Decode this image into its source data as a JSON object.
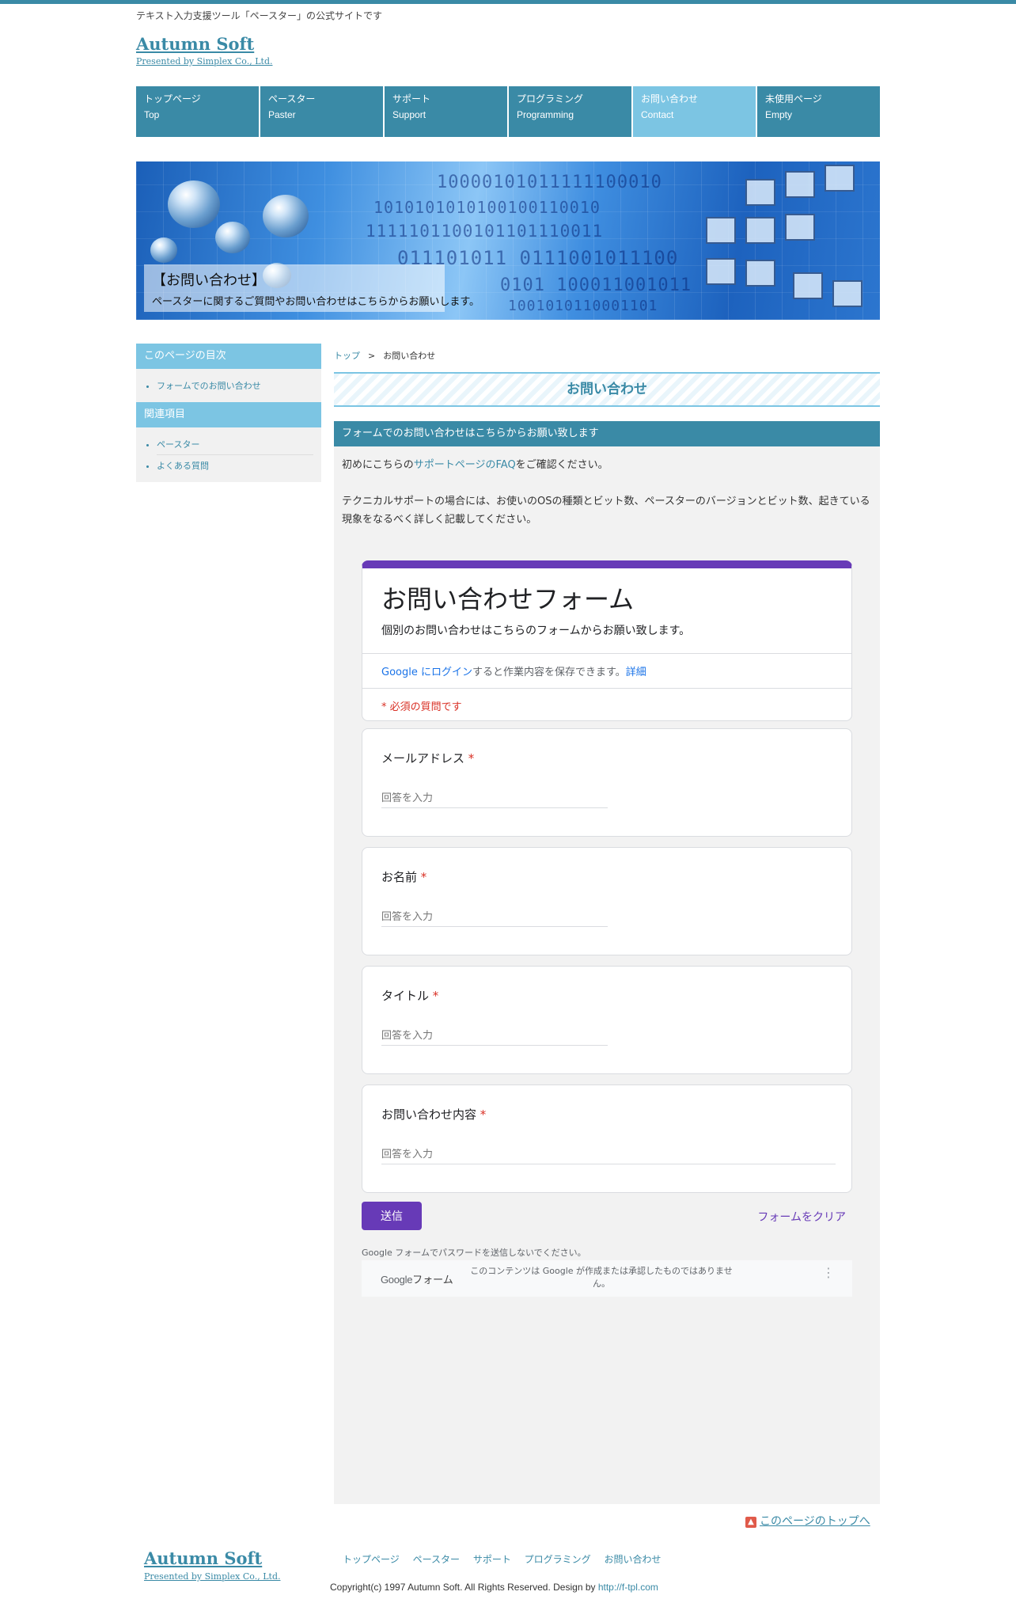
{
  "site": {
    "tagline": "テキスト入力支援ツール「ペースター」の公式サイトです",
    "logo": "Autumn Soft",
    "presented_by": "Presented by Simplex Co., Ltd."
  },
  "nav": [
    {
      "jp": "トップページ",
      "en": "Top"
    },
    {
      "jp": "ペースター",
      "en": "Paster"
    },
    {
      "jp": "サポート",
      "en": "Support"
    },
    {
      "jp": "プログラミング",
      "en": "Programming"
    },
    {
      "jp": "お問い合わせ",
      "en": "Contact",
      "active": true
    },
    {
      "jp": "未使用ページ",
      "en": "Empty"
    }
  ],
  "hero": {
    "title": "【お問い合わせ】",
    "description": "ペースターに関するご質問やお問い合わせはこちらからお願いします。"
  },
  "sidebar": {
    "toc_heading": "このページの目次",
    "toc_items": [
      "フォームでのお問い合わせ"
    ],
    "related_heading": "関連項目",
    "related_items": [
      "ペースター",
      "よくある質問"
    ]
  },
  "breadcrumb": {
    "home": "トップ",
    "separator": ">",
    "current": "お問い合わせ"
  },
  "page_title": "お問い合わせ",
  "section": {
    "heading": "フォームでのお問い合わせはこちらからお願い致します",
    "p1_before": "初めにこちらの",
    "p1_link": "サポートページのFAQ",
    "p1_after": "をご確認ください。",
    "p2": "テクニカルサポートの場合には、お使いのOSの種類とビット数、ペースターのバージョンとビット数、起きている現象をなるべく詳しく記載してください。"
  },
  "form": {
    "title": "お問い合わせフォーム",
    "description": "個別のお問い合わせはこちらのフォームからお願い致します。",
    "signin_link": "Google にログイン",
    "signin_text": "すると作業内容を保存できます。",
    "details_link": "詳細",
    "required_note": "* 必須の質問です",
    "questions": [
      {
        "label": "メールアドレス",
        "placeholder": "回答を入力"
      },
      {
        "label": "お名前",
        "placeholder": "回答を入力"
      },
      {
        "label": "タイトル",
        "placeholder": "回答を入力"
      },
      {
        "label": "お問い合わせ内容",
        "placeholder": "回答を入力"
      }
    ],
    "required_star": "*",
    "submit_label": "送信",
    "clear_label": "フォームをクリア",
    "password_warning": "Google フォームでパスワードを送信しないでください。",
    "footer_brand_g": "Google",
    "footer_brand_forms": "フォーム",
    "footer_disclaimer": "このコンテンツは Google が作成または承認したものではありません。",
    "more_icon": "⋮"
  },
  "to_top": {
    "icon": "▲",
    "label": "このページのトップへ"
  },
  "footer": {
    "logo": "Autumn Soft",
    "presented_by": "Presented by Simplex Co., Ltd.",
    "nav": [
      "トップページ",
      "ペースター",
      "サポート",
      "プログラミング",
      "お問い合わせ"
    ],
    "copyright": "Copyright(c) 1997 Autumn Soft. All Rights Reserved. Design by ",
    "design_link": "http://f-tpl.com"
  }
}
